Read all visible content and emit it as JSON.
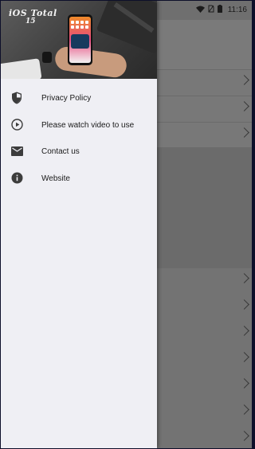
{
  "status_bar": {
    "time": "11:16"
  },
  "drawer": {
    "header": {
      "brand_title": "iOS Total",
      "brand_subtitle": "15"
    },
    "menu": [
      {
        "label": "Privacy Policy",
        "icon": "shield-icon"
      },
      {
        "label": "Please watch video to use",
        "icon": "play-circle-icon"
      },
      {
        "label": "Contact us",
        "icon": "mail-icon"
      },
      {
        "label": "Website",
        "icon": "info-icon"
      }
    ]
  },
  "colors": {
    "drawer_bg": "#efeff4",
    "scrim": "#737373",
    "icon": "#3c3c3c",
    "text": "#1a1a1a"
  }
}
